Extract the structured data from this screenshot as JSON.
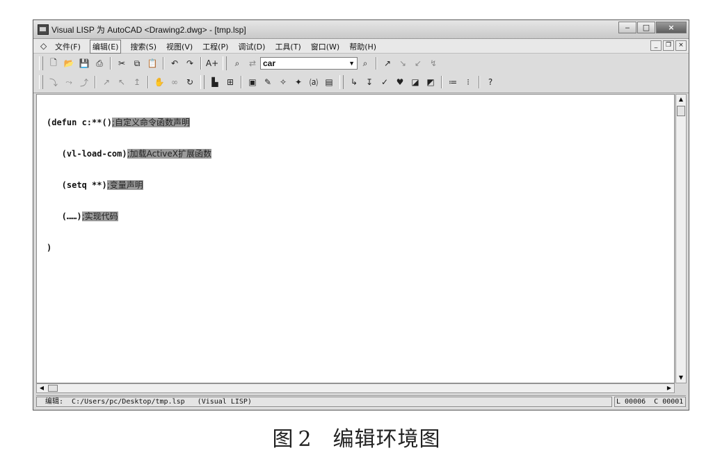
{
  "window": {
    "title": "Visual LISP 为 AutoCAD <Drawing2.dwg> - [tmp.lsp]",
    "controls": {
      "minimize": "‒",
      "maximize": "□",
      "close": "×"
    }
  },
  "menubar": {
    "items": [
      {
        "label": "文件(F)"
      },
      {
        "label": "编辑(E)"
      },
      {
        "label": "搜索(S)"
      },
      {
        "label": "视图(V)"
      },
      {
        "label": "工程(P)"
      },
      {
        "label": "调试(D)"
      },
      {
        "label": "工具(T)"
      },
      {
        "label": "窗口(W)"
      },
      {
        "label": "帮助(H)"
      }
    ],
    "mdi_controls": {
      "minimize": "_",
      "restore": "❐",
      "close": "×"
    }
  },
  "toolbar": {
    "search_value": "car"
  },
  "editor": {
    "lines": [
      {
        "code": "(defun c:**()",
        "comment": ";自定义命令函数声明"
      },
      {
        "code": "   (vl-load-com)",
        "comment": ";加载ActiveX扩展函数"
      },
      {
        "code": "   (setq **)",
        "comment": ";变量声明"
      },
      {
        "code": "   (……)",
        "comment": ";实现代码"
      },
      {
        "code": ")",
        "comment": ""
      }
    ]
  },
  "statusbar": {
    "left": "编辑:  C:/Users/pc/Desktop/tmp.lsp   (Visual LISP)",
    "right": "L 00006  C 00001"
  },
  "caption": {
    "label": "图",
    "number": "2",
    "text": "编辑环境图"
  }
}
